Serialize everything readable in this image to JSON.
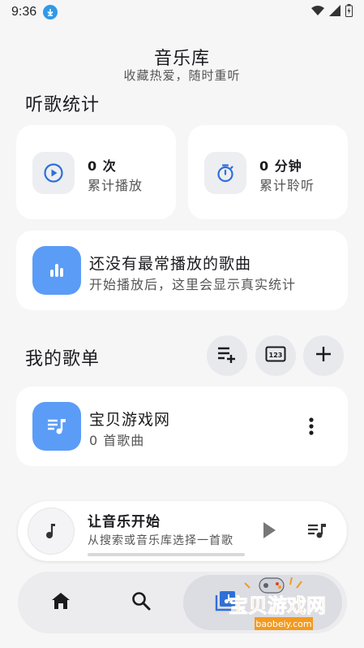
{
  "status_bar": {
    "time": "9:36",
    "icons": [
      "download-icon",
      "wifi-icon",
      "signal-icon",
      "battery-icon"
    ]
  },
  "header": {
    "title": "音乐库",
    "subtitle": "收藏热爱，随时重听"
  },
  "listening_stats": {
    "section_title": "听歌统计",
    "plays": {
      "value": "0 次",
      "label": "累计播放",
      "icon": "play-circle-icon"
    },
    "duration": {
      "value": "0 分钟",
      "label": "累计聆听",
      "icon": "timer-icon"
    },
    "top_song": {
      "title": "还没有最常播放的歌曲",
      "subtitle": "开始播放后，这里会显示真实统计",
      "icon": "bar-chart-icon"
    }
  },
  "playlists": {
    "section_title": "我的歌单",
    "actions": [
      "add-to-playlist-icon",
      "numbered-list-icon",
      "plus-icon"
    ],
    "items": [
      {
        "name": "宝贝游戏网",
        "count": "0 首歌曲",
        "icon": "music-list-icon"
      }
    ]
  },
  "mini_player": {
    "title": "让音乐开始",
    "subtitle": "从搜索或音乐库选择一首歌",
    "progress": 0
  },
  "bottom_nav": {
    "items": [
      "home-icon",
      "search-icon",
      "library-icon"
    ],
    "active": "library-icon"
  },
  "watermark": {
    "text": "宝贝游戏网",
    "url": "baobeiy.com"
  },
  "colors": {
    "accent": "#5b9cf7",
    "icon_blue": "#2f6fd6",
    "background": "#f6f6f7",
    "card": "#ffffff",
    "watermark_orange": "#f39a1e"
  }
}
